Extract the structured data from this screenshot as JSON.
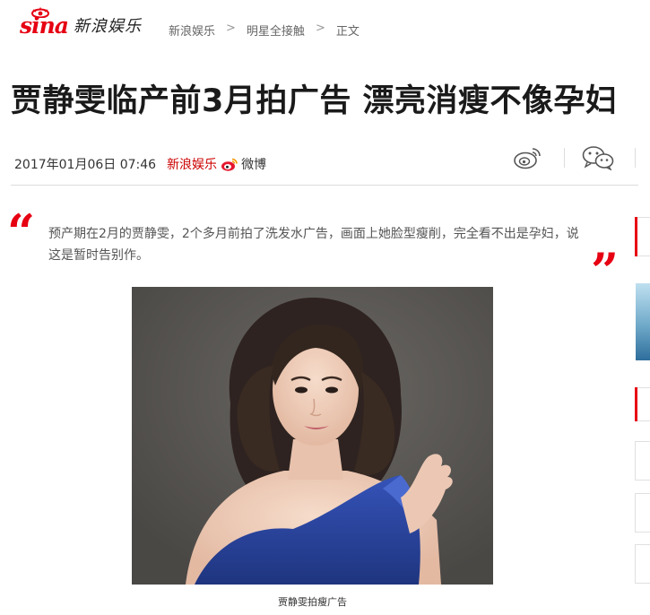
{
  "header": {
    "logo_brand": "sina",
    "logo_channel": "新浪娱乐",
    "breadcrumb": [
      "新浪娱乐",
      "明星全接触",
      "正文"
    ],
    "breadcrumb_separator": ">"
  },
  "article": {
    "title": "贾静雯临产前3月拍广告 漂亮消瘦不像孕妇",
    "date": "2017年01月06日 07:46",
    "source": "新浪娱乐",
    "weibo_label": "微博",
    "summary": "预产期在2月的贾静雯，2个多月前拍了洗发水广告，画面上她脸型瘦削，完全看不出是孕妇，说这是暂时告别作。",
    "image_caption": "贾静雯拍瘦广告"
  },
  "share": {
    "icons": [
      "weibo-share-icon",
      "wechat-share-icon"
    ]
  },
  "colors": {
    "brand_red": "#e60012",
    "title": "#1a1a1a",
    "text": "#555555",
    "photo_background": "#5b5955",
    "dress_blue": "#2b45a0"
  }
}
